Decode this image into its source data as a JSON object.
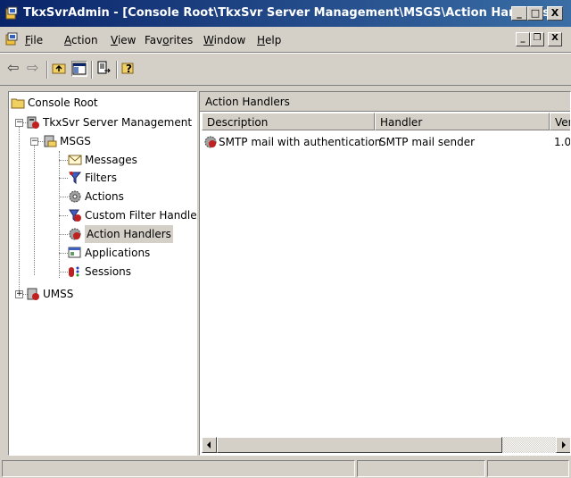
{
  "window": {
    "title": "TkxSvrAdmin - [Console Root\\TkxSvr Server Management\\MSGS\\Action Handlers]",
    "controls": {
      "minimize": "_",
      "maximize": "□",
      "close": "X"
    }
  },
  "menu": {
    "items": [
      {
        "label": "File",
        "key": "F",
        "rest": "ile"
      },
      {
        "label": "Action",
        "key": "A",
        "rest": "ction"
      },
      {
        "label": "View",
        "key": "V",
        "rest": "iew"
      },
      {
        "label": "Favorites",
        "pre": "Fav",
        "key": "o",
        "rest": "rites"
      },
      {
        "label": "Window",
        "key": "W",
        "rest": "indow"
      },
      {
        "label": "Help",
        "key": "H",
        "rest": "elp"
      }
    ],
    "mdi_controls": {
      "minimize": "_",
      "restore": "❐",
      "close": "X"
    }
  },
  "toolbar": {
    "back_glyph": "⇦",
    "forward_glyph": "⇨"
  },
  "tree": {
    "items": [
      {
        "label": "Console Root",
        "icon": "folder-icon"
      },
      {
        "label": "TkxSvr Server Management",
        "icon": "server-icon"
      },
      {
        "label": "MSGS",
        "icon": "msgs-icon"
      },
      {
        "label": "Messages",
        "icon": "envelope-icon"
      },
      {
        "label": "Filters",
        "icon": "filter-icon"
      },
      {
        "label": "Actions",
        "icon": "gear-icon"
      },
      {
        "label": "Custom Filter Handlers",
        "icon": "custom-filter-icon"
      },
      {
        "label": "Action Handlers",
        "icon": "action-handler-icon",
        "selected": true
      },
      {
        "label": "Applications",
        "icon": "application-icon"
      },
      {
        "label": "Sessions",
        "icon": "sessions-icon"
      },
      {
        "label": "UMSS",
        "icon": "umss-icon"
      }
    ],
    "expander_minus": "−",
    "expander_plus": "+"
  },
  "detail": {
    "title": "Action Handlers",
    "columns": [
      "Description",
      "Handler",
      "Ver"
    ],
    "rows": [
      {
        "description": "SMTP mail with authentication",
        "handler": "SMTP mail sender",
        "version": "1.0"
      }
    ]
  },
  "colors": {
    "title_start": "#0a246a",
    "title_end": "#3a6ea5",
    "face": "#d4d0c8"
  }
}
